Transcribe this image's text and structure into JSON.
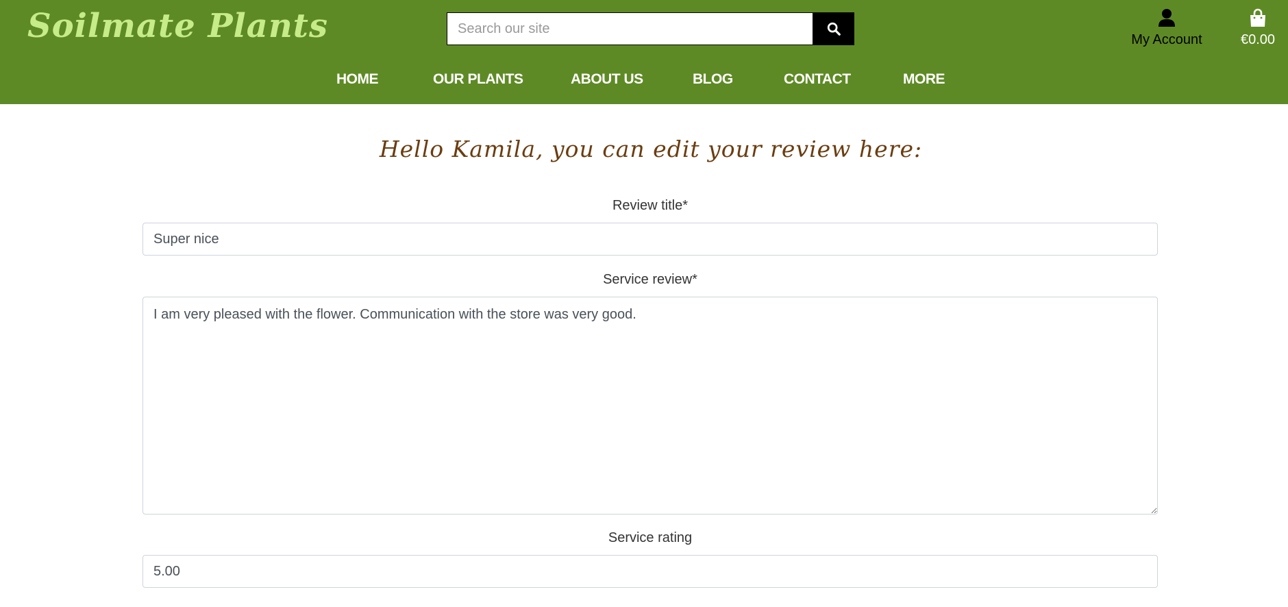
{
  "header": {
    "logo": "Soilmate Plants",
    "search": {
      "placeholder": "Search our site",
      "value": ""
    },
    "account_label": "My Account",
    "cart_total": "€0.00"
  },
  "nav": {
    "items": [
      "HOME",
      "OUR PLANTS",
      "ABOUT US",
      "BLOG",
      "CONTACT",
      "MORE"
    ]
  },
  "page": {
    "heading": "Hello Kamila, you can edit your review here:"
  },
  "form": {
    "title_label": "Review title*",
    "title_value": "Super nice",
    "review_label": "Service review*",
    "review_value": "I am very pleased with the flower. Communication with the store was very good.",
    "rating_label": "Service rating",
    "rating_value": "5.00"
  },
  "colors": {
    "header_bg": "#5e8a25",
    "logo": "#c6ec8a",
    "heading": "#6b3d10"
  },
  "icons": {
    "search": "search-icon",
    "account": "user-icon",
    "cart": "shopping-bag-icon"
  }
}
